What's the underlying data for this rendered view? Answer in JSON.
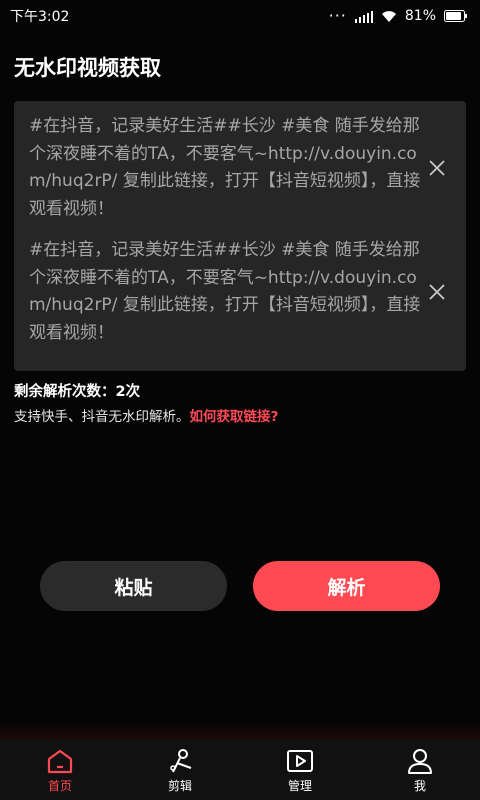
{
  "status_bar": {
    "time": "下午3:02",
    "battery": "81%"
  },
  "page": {
    "title": "无水印视频获取"
  },
  "links": [
    {
      "text": "#在抖音，记录美好生活##长沙 #美食 随手发给那个深夜睡不着的TA，不要客气~http://v.douyin.com/huq2rP/ 复制此链接，打开【抖音短视频】，直接观看视频！"
    },
    {
      "text": "#在抖音，记录美好生活##长沙 #美食 随手发给那个深夜睡不着的TA，不要客气~http://v.douyin.com/huq2rP/ 复制此链接，打开【抖音短视频】，直接观看视频！"
    }
  ],
  "info": {
    "remaining": "剩余解析次数：2次",
    "support": "支持快手、抖音无水印解析。",
    "how_link": "如何获取链接?"
  },
  "buttons": {
    "paste": "粘贴",
    "parse": "解析"
  },
  "tabs": [
    {
      "label": "首页",
      "icon": "home-icon",
      "active": true
    },
    {
      "label": "剪辑",
      "icon": "scissors-icon",
      "active": false
    },
    {
      "label": "管理",
      "icon": "play-icon",
      "active": false
    },
    {
      "label": "我",
      "icon": "user-icon",
      "active": false
    }
  ],
  "colors": {
    "accent": "#ff4a53",
    "background": "#050505",
    "panel": "#262626"
  }
}
